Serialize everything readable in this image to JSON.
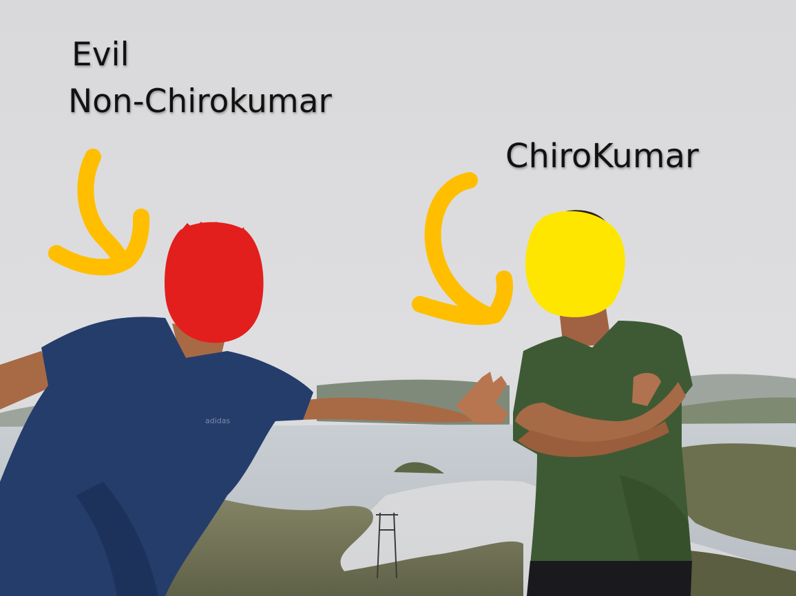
{
  "labels": {
    "left_line1": "Evil",
    "left_line2": "Non-Chirokumar",
    "right": "ChiroKumar"
  },
  "colors": {
    "sky": "#dcdcde",
    "arrow": "#ffbf00",
    "left_face_scribble": "#e5201d",
    "right_face_scribble": "#ffe600",
    "left_shirt": "#243c68",
    "right_shirt": "#3f5a34",
    "skin": "#b0704a",
    "lake": "#c3c8ce",
    "hills": "#8f9a8a"
  },
  "icons": {
    "left_arrow": "curved-down-arrow",
    "right_arrow": "curved-down-arrow"
  }
}
